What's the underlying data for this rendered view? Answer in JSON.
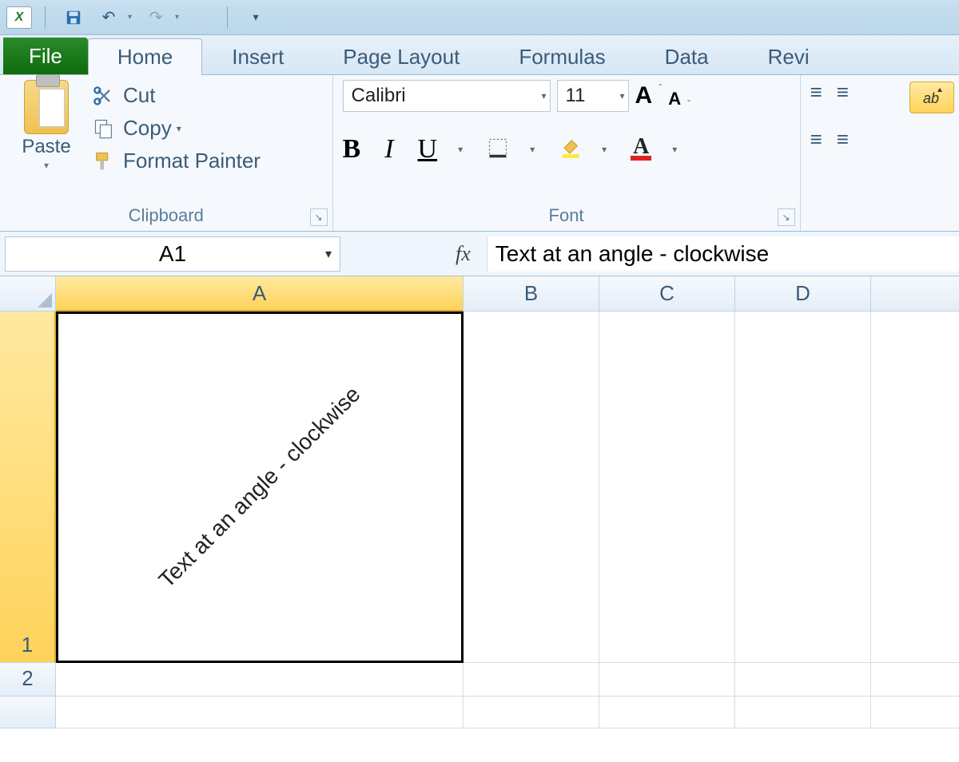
{
  "qat": {
    "app_initial": "X"
  },
  "tabs": {
    "file": "File",
    "items": [
      "Home",
      "Insert",
      "Page Layout",
      "Formulas",
      "Data",
      "Revi"
    ],
    "active_index": 0
  },
  "ribbon": {
    "clipboard": {
      "label": "Clipboard",
      "paste": "Paste",
      "cut": "Cut",
      "copy": "Copy",
      "format_painter": "Format Painter"
    },
    "font": {
      "label": "Font",
      "name": "Calibri",
      "size": "11",
      "grow": "A",
      "shrink": "A",
      "bold": "B",
      "italic": "I",
      "underline": "U",
      "font_color_letter": "A"
    }
  },
  "formula_bar": {
    "name_box": "A1",
    "fx_label": "fx",
    "value": "Text at an angle - clockwise"
  },
  "columns": [
    "A",
    "B",
    "C",
    "D"
  ],
  "rows": [
    "1",
    "2"
  ],
  "cells": {
    "A1": "Text at an angle - clockwise"
  }
}
